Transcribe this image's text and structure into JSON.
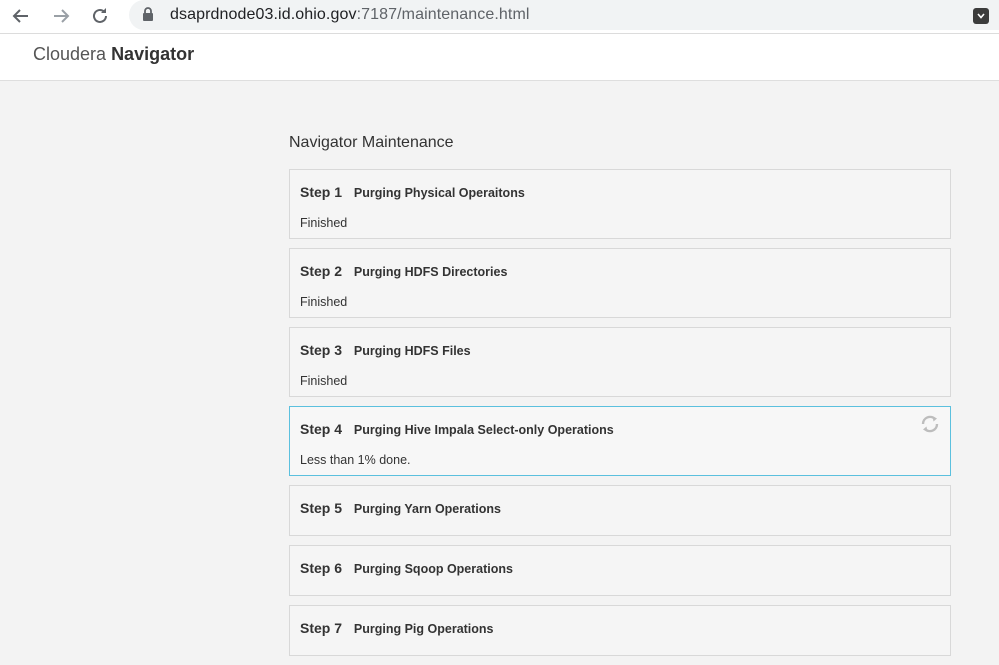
{
  "browser": {
    "url_host": "dsaprdnode03.id.ohio.gov",
    "url_path": ":7187/maintenance.html"
  },
  "header": {
    "brand_light": "Cloudera",
    "brand_bold": "Navigator"
  },
  "main": {
    "title": "Navigator Maintenance",
    "steps": [
      {
        "num": "Step 1",
        "name": "Purging Physical Operaitons",
        "status": "Finished"
      },
      {
        "num": "Step 2",
        "name": "Purging HDFS Directories",
        "status": "Finished"
      },
      {
        "num": "Step 3",
        "name": "Purging HDFS Files",
        "status": "Finished"
      },
      {
        "num": "Step 4",
        "name": "Purging Hive Impala Select-only Operations",
        "status": "Less than 1% done."
      },
      {
        "num": "Step 5",
        "name": "Purging Yarn Operations"
      },
      {
        "num": "Step 6",
        "name": "Purging Sqoop Operations"
      },
      {
        "num": "Step 7",
        "name": "Purging Pig Operations"
      }
    ]
  },
  "colors": {
    "active_border": "#5bc0de",
    "background": "#f3f3f3"
  },
  "icons": [
    "back-arrow-icon",
    "forward-arrow-icon",
    "reload-icon",
    "lock-icon",
    "extension-icon",
    "spinner-icon"
  ]
}
